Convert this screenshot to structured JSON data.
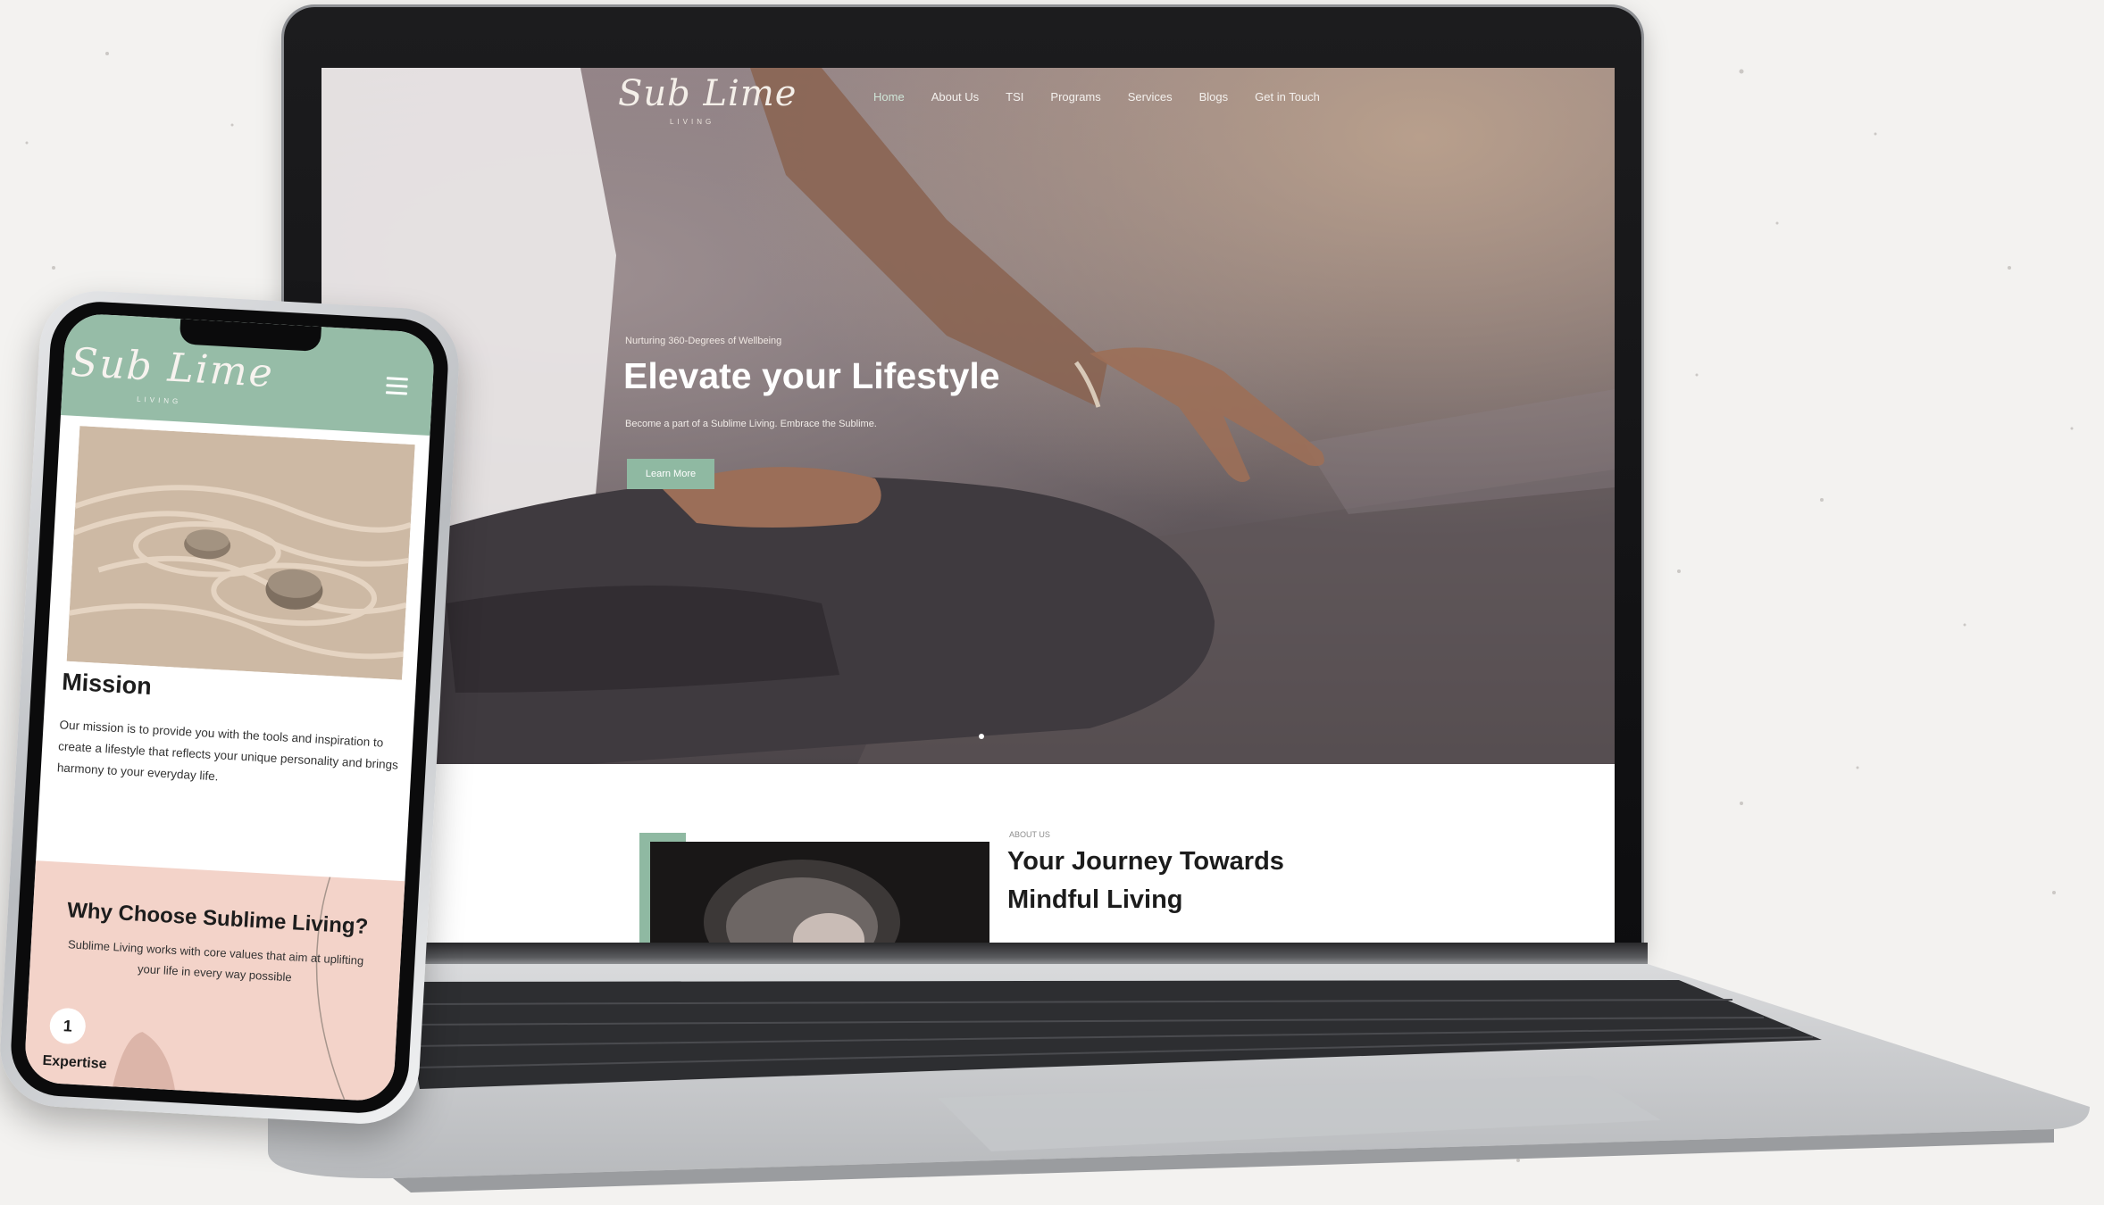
{
  "desktop_site": {
    "logo": "Sub Lime",
    "logo_tagline": "LIVING",
    "nav": [
      "Home",
      "About Us",
      "TSI",
      "Programs",
      "Services",
      "Blogs",
      "Get in Touch"
    ],
    "active_nav": "Home",
    "hero": {
      "eyebrow": "Nurturing 360-Degrees of Wellbeing",
      "title": "Elevate your Lifestyle",
      "subtitle": "Become a part of a Sublime Living. Embrace the Sublime.",
      "button": "Learn More"
    },
    "about": {
      "eyebrow": "ABOUT US",
      "title": "Your Journey Towards Mindful Living"
    }
  },
  "mobile_site": {
    "logo": "Sub Lime",
    "logo_tagline": "LIVING",
    "mission": {
      "title": "Mission",
      "text": "Our mission is to provide you with the tools and inspiration to create a lifestyle that reflects your unique personality and brings harmony to your everyday life."
    },
    "why": {
      "title": "Why Choose Sublime Living?",
      "text": "Sublime Living works with core values that aim at uplifting your life in every way possible",
      "item_number": "1",
      "item_label": "Expertise"
    }
  },
  "colors": {
    "accent_green": "#8fb9a2",
    "blush_pink": "#f3d3c9"
  }
}
